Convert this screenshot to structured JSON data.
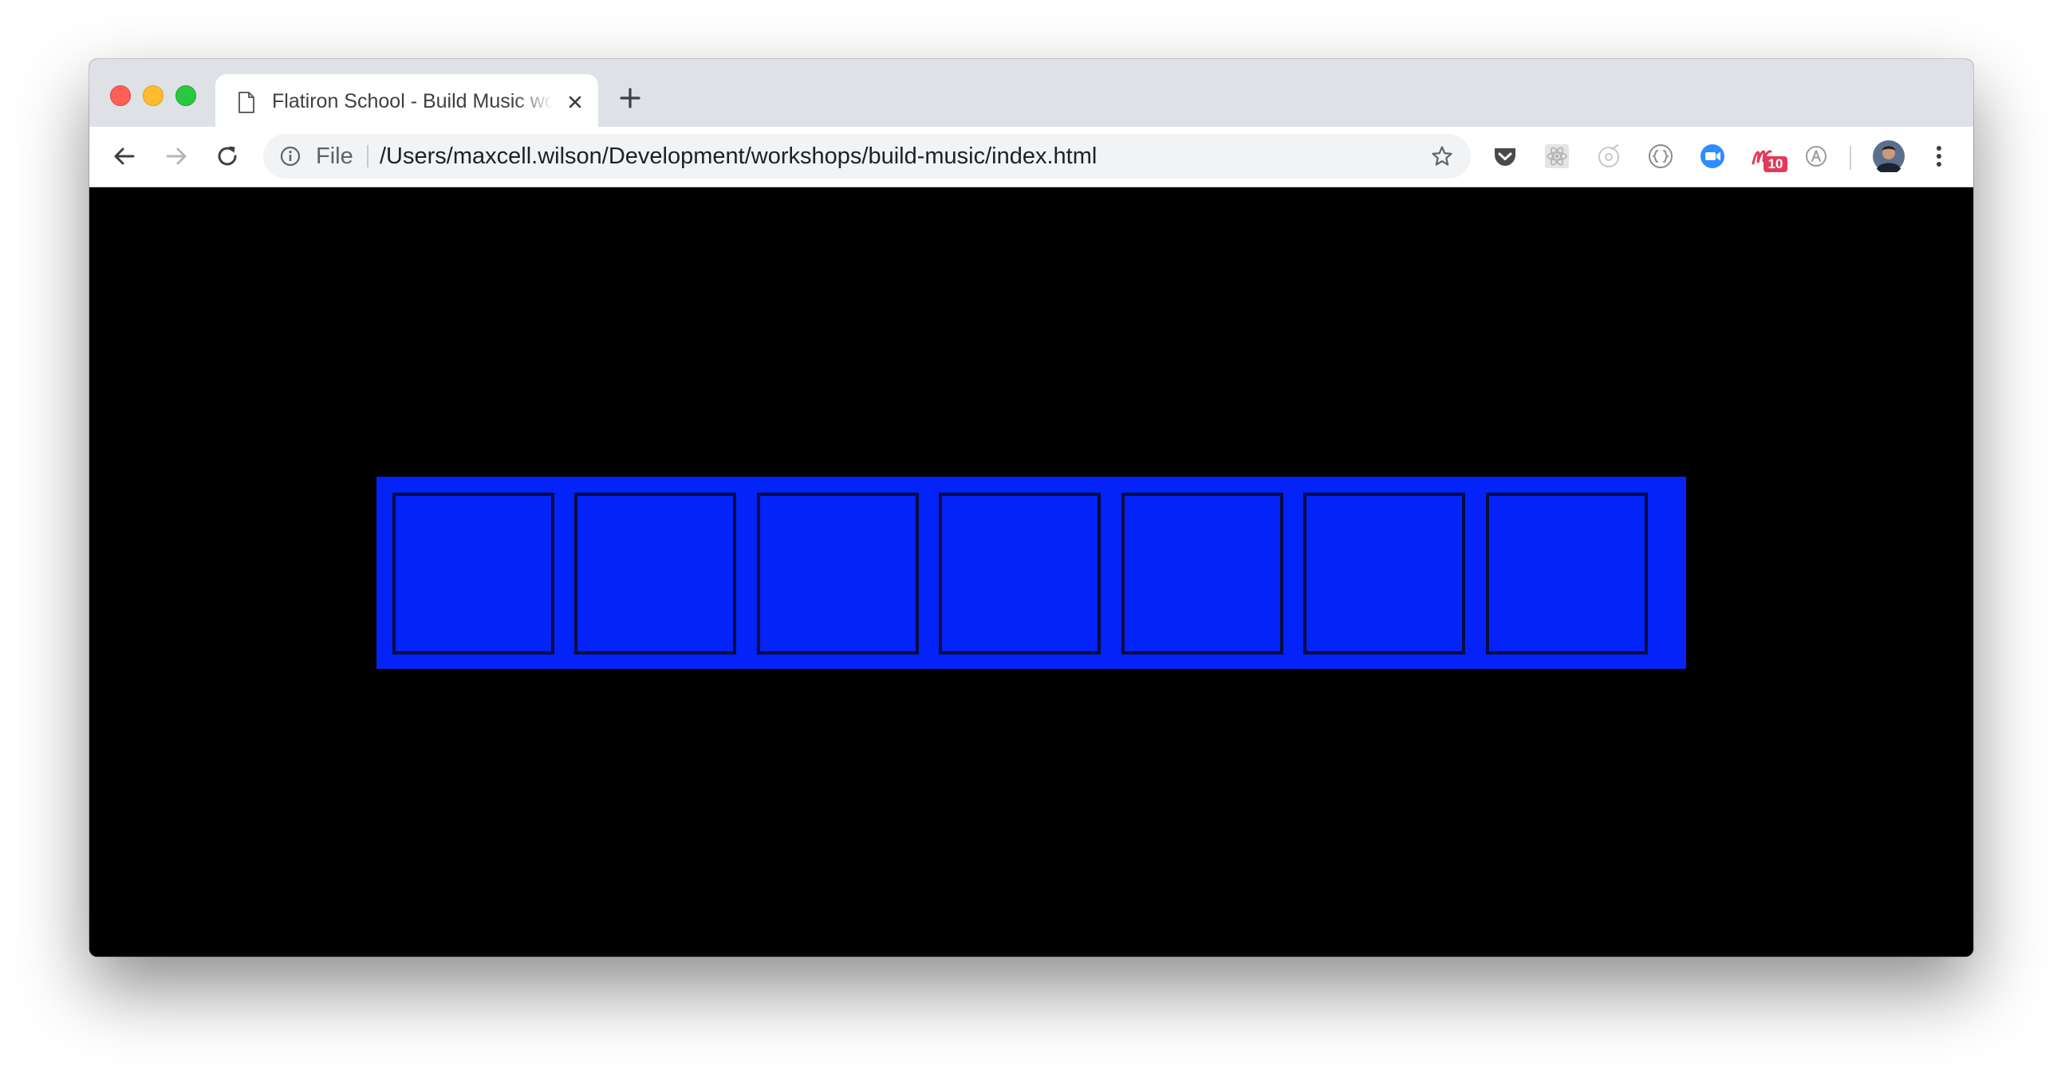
{
  "browser": {
    "tab": {
      "title": "Flatiron School - Build Music workshop",
      "favicon": "document-icon"
    },
    "address_bar": {
      "scheme_label": "File",
      "url": "/Users/maxcell.wilson/Development/workshops/build-music/index.html"
    },
    "extensions": [
      {
        "icon": "pocket-icon"
      },
      {
        "icon": "react-devtools-icon"
      },
      {
        "icon": "cursor-extension-icon"
      },
      {
        "icon": "json-viewer-icon"
      },
      {
        "icon": "zoom-video-icon"
      },
      {
        "icon": "momentum-icon",
        "badge": "10"
      },
      {
        "icon": "grammar-extension-icon"
      }
    ],
    "colors": {
      "tabstrip": "#dee1e6",
      "toolbar": "#ffffff",
      "zoom_blue": "#2d8cff",
      "badge": "#e5395a"
    }
  },
  "page": {
    "background": "#000000",
    "keyboard": {
      "color": "#0323f9",
      "key_count": 7
    }
  }
}
